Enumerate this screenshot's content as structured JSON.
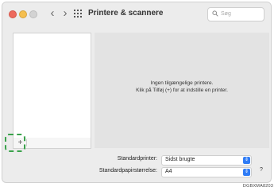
{
  "window": {
    "title": "Printere & scannere",
    "search_placeholder": "Søg"
  },
  "toolbar": {
    "back_label": "‹",
    "forward_label": "›"
  },
  "printer_list": {
    "add_label": "+"
  },
  "detail": {
    "line1": "Ingen tilgængelige printere.",
    "line2": "Klik på Tilføj (+) for at indstille en printer."
  },
  "settings": {
    "default_printer_label": "Standardprinter:",
    "default_printer_value": "Sidst brugte",
    "default_paper_label": "Standardpapirstørrelse:",
    "default_paper_value": "A4",
    "help_label": "?"
  },
  "figure_code": "DGBXMA8203",
  "colors": {
    "highlight": "#3aa24b",
    "accent": "#2f7cf6"
  }
}
